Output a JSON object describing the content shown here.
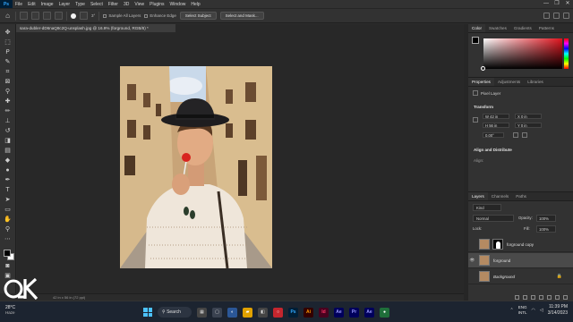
{
  "menubar": {
    "logo": "Ps",
    "items": [
      "File",
      "Edit",
      "Image",
      "Layer",
      "Type",
      "Select",
      "Filter",
      "3D",
      "View",
      "Plugins",
      "Window",
      "Help"
    ],
    "window_controls": [
      "—",
      "❐",
      "✕"
    ]
  },
  "options": {
    "brush_size": "3°",
    "sample_all_layers": "Sample All Layers",
    "enhance_edge": "Enhance Edge",
    "select_subject": "Select Subject",
    "select_and_mask": "Select and Mask..."
  },
  "document": {
    "tab_title": "sara-dubler-dD6naQ8c2Q-unsplash.jpg @ 16.9% (forground, RGB/8) *",
    "status": "42 in x 56 in (72 ppi)"
  },
  "panels": {
    "color_tabs": [
      "Color",
      "Swatches",
      "Gradients",
      "Patterns"
    ],
    "props_tabs": [
      "Properties",
      "Adjustments",
      "Libraries"
    ],
    "layer_type": "Pixel Layer",
    "transform_label": "Transform",
    "w": "W  42 in",
    "h": "H  56 in",
    "x": "X  0 in",
    "y": "Y  0 in",
    "angle": "0.00°",
    "align_label": "Align and Distribute",
    "align_sub": "Align:",
    "layers_tabs": [
      "Layers",
      "Channels",
      "Paths"
    ],
    "filter": "Kind",
    "blend_mode": "Normal",
    "opacity_label": "Opacity:",
    "opacity": "100%",
    "lock_label": "Lock:",
    "fill_label": "Fill:",
    "fill": "100%",
    "layers": [
      {
        "name": "forground copy",
        "visible": false,
        "mask": true,
        "selected": false,
        "italic": false
      },
      {
        "name": "forground",
        "visible": true,
        "mask": false,
        "selected": true,
        "italic": false
      },
      {
        "name": "Background",
        "visible": false,
        "mask": false,
        "selected": false,
        "italic": true,
        "locked": true
      }
    ]
  },
  "taskbar": {
    "temp": "28°C",
    "weather": "Haze",
    "search": "Search",
    "apps": [
      {
        "label": "Ps",
        "bg": "#001e36",
        "fg": "#31a8ff"
      },
      {
        "label": "Ai",
        "bg": "#330000",
        "fg": "#ff9a00"
      },
      {
        "label": "Id",
        "bg": "#49021f",
        "fg": "#ff3366"
      },
      {
        "label": "Ae",
        "bg": "#00005b",
        "fg": "#9999ff"
      },
      {
        "label": "Pr",
        "bg": "#00005b",
        "fg": "#9999ff"
      },
      {
        "label": "Ae",
        "bg": "#00005b",
        "fg": "#9999ff"
      }
    ],
    "lang_top": "ENG",
    "lang_bottom": "INTL",
    "time": "11:39 PM",
    "date": "3/14/2023"
  }
}
